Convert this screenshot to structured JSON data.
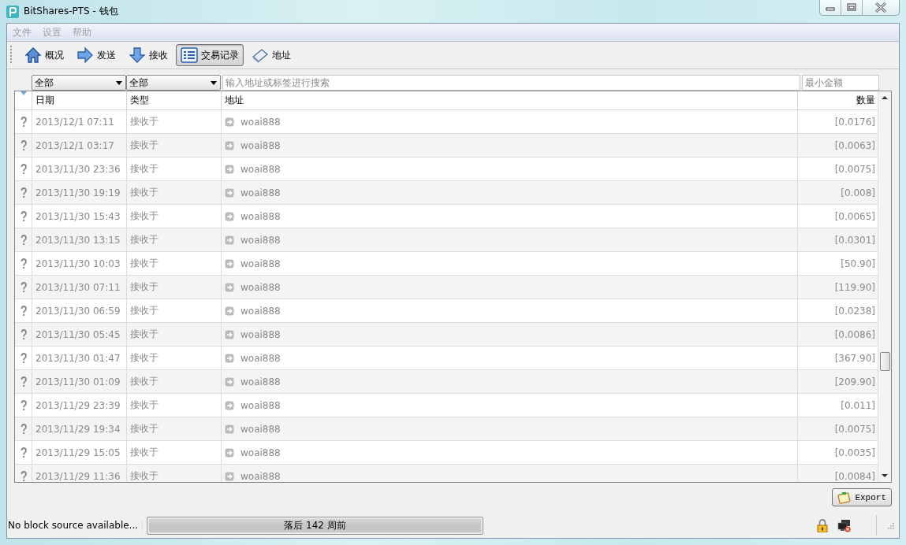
{
  "window": {
    "title": "BitShares-PTS - 钱包"
  },
  "menu": [
    {
      "label": "文件",
      "disabled": true
    },
    {
      "label": "设置",
      "disabled": true
    },
    {
      "label": "帮助",
      "disabled": true
    }
  ],
  "toolbar": {
    "items": [
      {
        "kind": "home",
        "label": "概况",
        "selected": false
      },
      {
        "kind": "send",
        "label": "发送",
        "selected": false
      },
      {
        "kind": "receive",
        "label": "接收",
        "selected": false
      },
      {
        "kind": "list",
        "label": "交易记录",
        "selected": true
      },
      {
        "kind": "book",
        "label": "地址",
        "selected": false
      }
    ]
  },
  "filters": {
    "date": "全部",
    "type": "全部",
    "search": {
      "placeholder": "输入地址或标签进行搜索"
    },
    "min_amount": {
      "placeholder": "最小金额"
    }
  },
  "table": {
    "columns": [
      "日期",
      "类型",
      "地址",
      "数量"
    ],
    "rows": [
      {
        "date": "2013/12/1 07:11",
        "type": "接收于",
        "address": "woai888",
        "amount": "[0.0176]"
      },
      {
        "date": "2013/12/1 03:17",
        "type": "接收于",
        "address": "woai888",
        "amount": "[0.0063]"
      },
      {
        "date": "2013/11/30 23:36",
        "type": "接收于",
        "address": "woai888",
        "amount": "[0.0075]"
      },
      {
        "date": "2013/11/30 19:19",
        "type": "接收于",
        "address": "woai888",
        "amount": "[0.008]"
      },
      {
        "date": "2013/11/30 15:43",
        "type": "接收于",
        "address": "woai888",
        "amount": "[0.0065]"
      },
      {
        "date": "2013/11/30 13:15",
        "type": "接收于",
        "address": "woai888",
        "amount": "[0.0301]"
      },
      {
        "date": "2013/11/30 10:03",
        "type": "接收于",
        "address": "woai888",
        "amount": "[50.90]"
      },
      {
        "date": "2013/11/30 07:11",
        "type": "接收于",
        "address": "woai888",
        "amount": "[119.90]"
      },
      {
        "date": "2013/11/30 06:59",
        "type": "接收于",
        "address": "woai888",
        "amount": "[0.0238]"
      },
      {
        "date": "2013/11/30 05:45",
        "type": "接收于",
        "address": "woai888",
        "amount": "[0.0086]"
      },
      {
        "date": "2013/11/30 01:47",
        "type": "接收于",
        "address": "woai888",
        "amount": "[367.90]"
      },
      {
        "date": "2013/11/30 01:09",
        "type": "接收于",
        "address": "woai888",
        "amount": "[209.90]"
      },
      {
        "date": "2013/11/29 23:39",
        "type": "接收于",
        "address": "woai888",
        "amount": "[0.011]"
      },
      {
        "date": "2013/11/29 19:34",
        "type": "接收于",
        "address": "woai888",
        "amount": "[0.0075]"
      },
      {
        "date": "2013/11/29 15:05",
        "type": "接收于",
        "address": "woai888",
        "amount": "[0.0035]"
      },
      {
        "date": "2013/11/29 11:36",
        "type": "接收于",
        "address": "woai888",
        "amount": "[0.0084]"
      }
    ]
  },
  "export_button": "Export",
  "status_bar": {
    "message": "No block source available...",
    "progress": {
      "label": "落后 142 周前",
      "level": 1
    }
  }
}
